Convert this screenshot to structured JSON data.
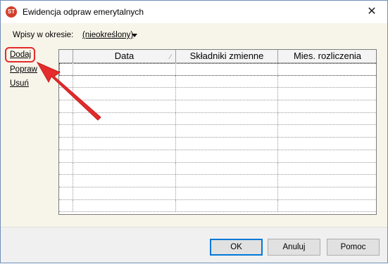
{
  "window": {
    "title": "Ewidencja odpraw emerytalnych",
    "app_icon": "app-logo-icon",
    "close_glyph": "✕"
  },
  "filter": {
    "label": "Wpisy w okresie:",
    "value": "(nieokreślony)"
  },
  "side_links": [
    "Dodaj",
    "Popraw",
    "Usuń"
  ],
  "grid": {
    "columns": [
      "Data",
      "Składniki zmienne",
      "Mies. rozliczenia"
    ],
    "sort_glyph": "∕",
    "rows": [
      [
        "",
        "",
        ""
      ],
      [
        "",
        "",
        ""
      ],
      [
        "",
        "",
        ""
      ],
      [
        "",
        "",
        ""
      ],
      [
        "",
        "",
        ""
      ],
      [
        "",
        "",
        ""
      ],
      [
        "",
        "",
        ""
      ],
      [
        "",
        "",
        ""
      ],
      [
        "",
        "",
        ""
      ],
      [
        "",
        "",
        ""
      ],
      [
        "",
        "",
        ""
      ],
      [
        "",
        "",
        ""
      ]
    ]
  },
  "buttons": {
    "ok": "OK",
    "cancel": "Anuluj",
    "help": "Pomoc"
  },
  "colors": {
    "accent_border": "#0078d7",
    "annotation": "#e52b2b"
  }
}
